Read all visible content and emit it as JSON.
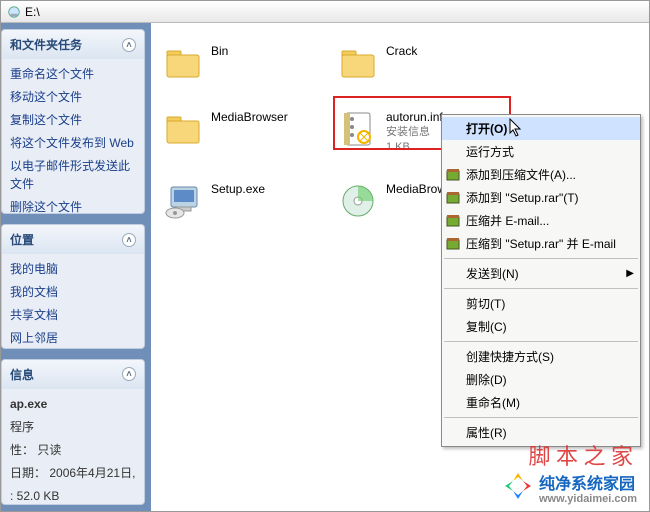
{
  "address": {
    "path": "E:\\"
  },
  "sidebar": {
    "tasks": {
      "title": "和文件夹任务",
      "items": [
        "重命名这个文件",
        "移动这个文件",
        "复制这个文件",
        "将这个文件发布到 Web",
        "以电子邮件形式发送此文件",
        "删除这个文件"
      ]
    },
    "places": {
      "title": "位置",
      "items": [
        "我的电脑",
        "我的文档",
        "共享文档",
        "网上邻居"
      ]
    },
    "details": {
      "title": "信息",
      "filename": "ap.exe",
      "filetype": "程序",
      "attr_label": "性：",
      "attr_value": "只读",
      "date_label": "日期：",
      "date_value": "2006年4月21日,",
      "size_line": ": 52.0 KB"
    }
  },
  "content": {
    "items": [
      {
        "type": "folder",
        "name": "Bin"
      },
      {
        "type": "folder",
        "name": "Crack"
      },
      {
        "type": "folder",
        "name": "MediaBrowser"
      },
      {
        "type": "inf",
        "name": "autorun.inf",
        "sub1": "安装信息",
        "sub2": "1 KB"
      },
      {
        "type": "setup",
        "name": "Setup.exe"
      },
      {
        "type": "disc",
        "name": "MediaBrowser."
      }
    ]
  },
  "context_menu": {
    "open": "打开(O)",
    "runas": "运行方式",
    "rar_add": "添加到压缩文件(A)...",
    "rar_add_named": "添加到 \"Setup.rar\"(T)",
    "rar_email": "压缩并 E-mail...",
    "rar_named_email": "压缩到 \"Setup.rar\" 并 E-mail",
    "sendto": "发送到(N)",
    "cut": "剪切(T)",
    "copy": "复制(C)",
    "shortcut": "创建快捷方式(S)",
    "delete": "删除(D)",
    "rename": "重命名(M)",
    "properties": "属性(R)"
  },
  "watermark": "脚 本 之 家",
  "brand": {
    "cn": "纯净系统家园",
    "url": "www.yidaimei.com"
  }
}
